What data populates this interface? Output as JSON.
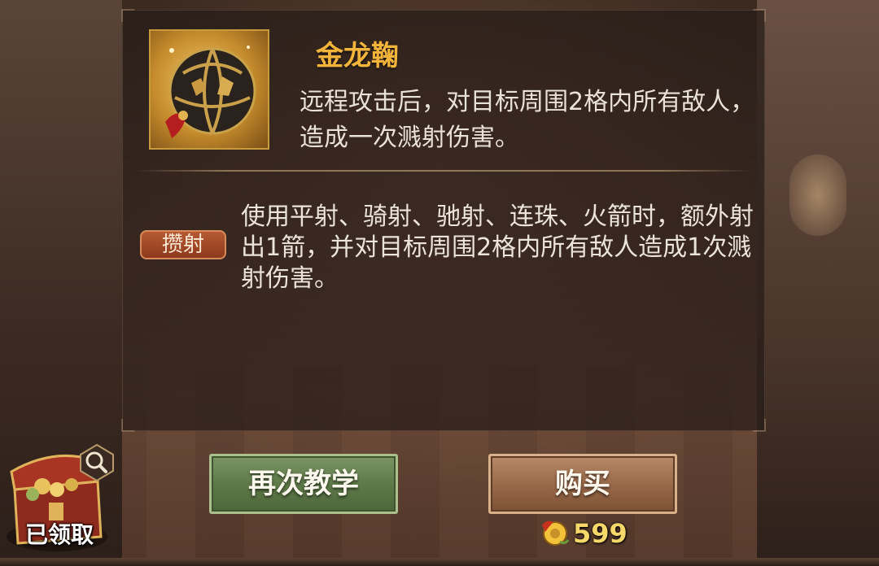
{
  "item": {
    "name": "金龙鞠",
    "description": "远程攻击后，对目标周围2格内所有敌人，造成一次溅射伤害。",
    "icon": "golden-dragon-ball-icon"
  },
  "skill": {
    "badge": "攒射",
    "description": "使用平射、骑射、驰射、连珠、火箭时，额外射出1箭，并对目标周围2格内所有敌人造成1次溅射伤害。"
  },
  "chest": {
    "label": "已领取",
    "icon": "treasure-chest-icon",
    "search_icon": "magnifier-icon"
  },
  "buttons": {
    "teach_again": "再次教学",
    "buy": "购买"
  },
  "price": {
    "amount": "599",
    "currency_icon": "gold-ingot-icon"
  },
  "colors": {
    "item_name": "#f2b43a",
    "teach_button": "#5f7a49",
    "buy_button": "#9a6a4a",
    "skill_badge": "#a24a27",
    "price_text": "#f6d86a"
  }
}
